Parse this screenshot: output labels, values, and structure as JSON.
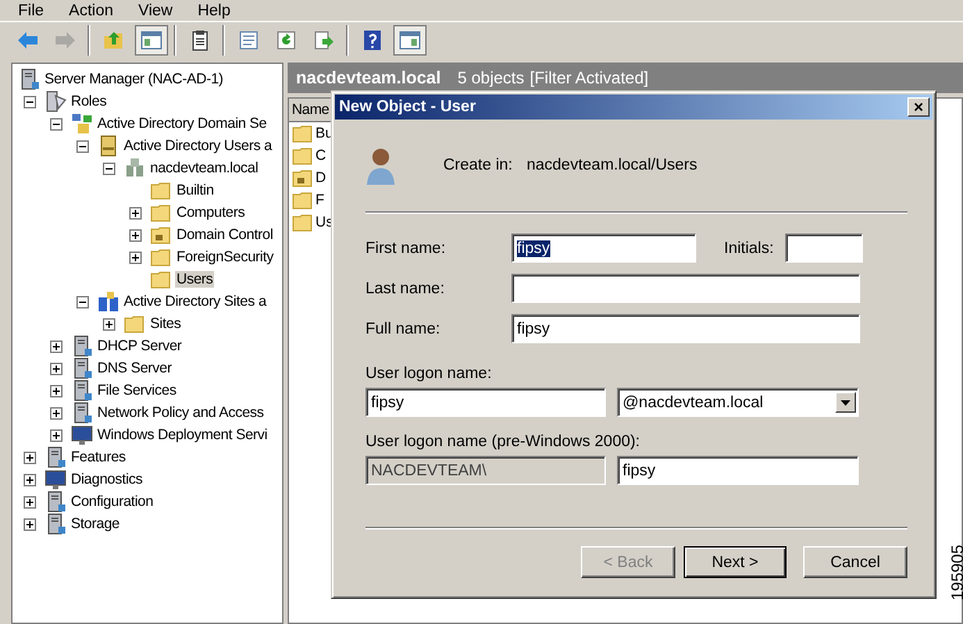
{
  "menu": [
    "File",
    "Action",
    "View",
    "Help"
  ],
  "toolbar": [
    [
      {
        "kind": "back",
        "disabled": false,
        "pressed": false
      },
      {
        "kind": "forward",
        "disabled": true,
        "pressed": false
      }
    ],
    [
      {
        "kind": "up",
        "disabled": false,
        "pressed": false
      },
      {
        "kind": "tree",
        "disabled": false,
        "pressed": true
      }
    ],
    [
      {
        "kind": "clipboard",
        "disabled": false,
        "pressed": false
      }
    ],
    [
      {
        "kind": "properties",
        "disabled": false,
        "pressed": false
      },
      {
        "kind": "refresh",
        "disabled": false,
        "pressed": false
      },
      {
        "kind": "export",
        "disabled": false,
        "pressed": false
      }
    ],
    [
      {
        "kind": "help",
        "disabled": false,
        "pressed": false
      },
      {
        "kind": "pane",
        "disabled": false,
        "pressed": true
      }
    ]
  ],
  "tree": [
    {
      "label": "Server Manager (NAC-AD-1)",
      "kind": "server",
      "selected": false,
      "children": [
        {
          "label": "Roles",
          "kind": "roles",
          "expanded": true,
          "selected": false,
          "children": [
            {
              "label": "Active Directory Domain Se",
              "kind": "directory",
              "expanded": true,
              "selected": false,
              "children": [
                {
                  "label": "Active Directory Users a",
                  "kind": "book",
                  "expanded": true,
                  "selected": false,
                  "children": [
                    {
                      "label": "nacdevteam.local",
                      "kind": "domain",
                      "expanded": true,
                      "selected": false,
                      "children": [
                        {
                          "label": "Builtin",
                          "kind": "folder",
                          "selected": false
                        },
                        {
                          "label": "Computers",
                          "kind": "folder",
                          "expanded": false,
                          "selected": false
                        },
                        {
                          "label": "Domain Control",
                          "kind": "ou",
                          "expanded": false,
                          "selected": false
                        },
                        {
                          "label": "ForeignSecurity",
                          "kind": "folder",
                          "expanded": false,
                          "selected": false
                        },
                        {
                          "label": "Users",
                          "kind": "folder",
                          "selected": true
                        }
                      ]
                    }
                  ]
                },
                {
                  "label": "Active Directory Sites a",
                  "kind": "sites",
                  "expanded": true,
                  "selected": false,
                  "children": [
                    {
                      "label": "Sites",
                      "kind": "folder",
                      "expanded": false,
                      "selected": false
                    }
                  ]
                }
              ]
            },
            {
              "label": "DHCP Server",
              "kind": "server",
              "expanded": false,
              "selected": false
            },
            {
              "label": "DNS Server",
              "kind": "server",
              "expanded": false,
              "selected": false
            },
            {
              "label": "File Services",
              "kind": "server",
              "expanded": false,
              "selected": false
            },
            {
              "label": "Network Policy and Access",
              "kind": "server",
              "expanded": false,
              "selected": false
            },
            {
              "label": "Windows Deployment Servi",
              "kind": "monitor",
              "expanded": false,
              "selected": false
            }
          ]
        },
        {
          "label": "Features",
          "kind": "server",
          "expanded": false,
          "selected": false
        },
        {
          "label": "Diagnostics",
          "kind": "monitor",
          "expanded": false,
          "selected": false
        },
        {
          "label": "Configuration",
          "kind": "server",
          "expanded": false,
          "selected": false
        },
        {
          "label": "Storage",
          "kind": "server",
          "expanded": false,
          "selected": false
        }
      ]
    }
  ],
  "content": {
    "title": "nacdevteam.local",
    "count": "5 objects",
    "filter": "[Filter Activated]",
    "columns": [
      "Name"
    ],
    "rows": [
      {
        "name": "Bu",
        "kind": "folder"
      },
      {
        "name": "C",
        "kind": "folder"
      },
      {
        "name": "D",
        "kind": "ou"
      },
      {
        "name": "F",
        "kind": "folder"
      },
      {
        "name": "Us",
        "kind": "folder"
      }
    ]
  },
  "dialog": {
    "title": "New Object - User",
    "close": "×",
    "create_in_label": "Create in:",
    "create_in_value": "nacdevteam.local/Users",
    "first_name": {
      "label": "First name:",
      "value": "fipsy",
      "highlighted": true
    },
    "initials": {
      "label": "Initials:"
    },
    "last_name": {
      "label": "Last name:"
    },
    "full_name": {
      "label": "Full name:",
      "value": "fipsy",
      "highlighted": false
    },
    "logon": {
      "label": "User logon name:",
      "value": "fipsy",
      "domain": "@nacdevteam.local"
    },
    "pre2000": {
      "label": "User logon name (pre-Windows 2000):",
      "domain": "NACDEVTEAM\\",
      "value": "fipsy"
    },
    "buttons": [
      {
        "label": "< Back",
        "disabled": true,
        "default": false
      },
      {
        "label": "Next >",
        "disabled": false,
        "default": true
      },
      {
        "label": "Cancel",
        "disabled": false,
        "default": false
      }
    ]
  },
  "figure_id": "195905"
}
